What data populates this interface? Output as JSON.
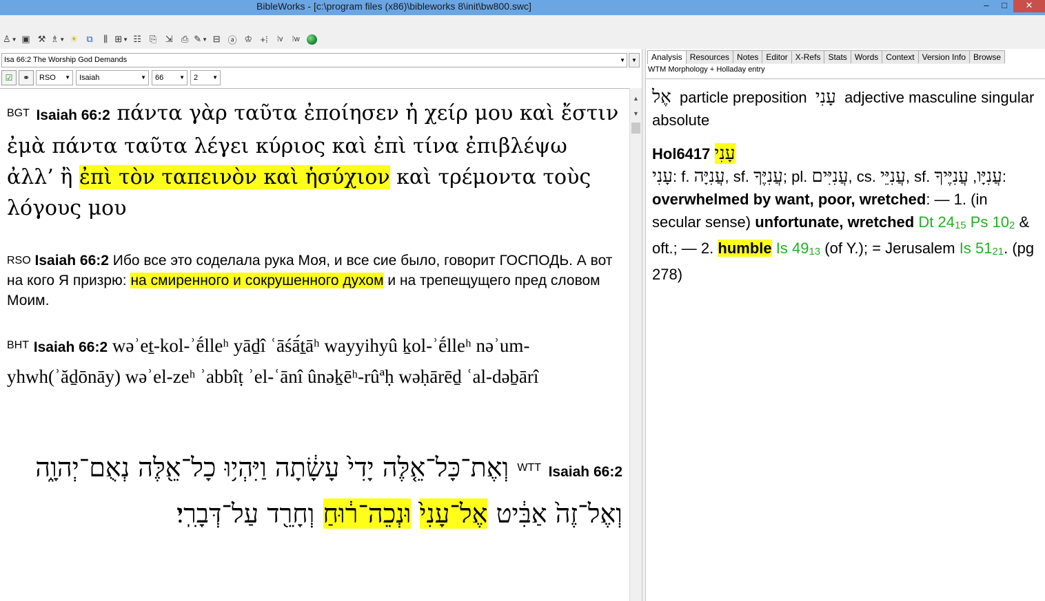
{
  "window": {
    "title": "BibleWorks - [c:\\program files (x86)\\bibleworks 8\\init\\bw800.swc]",
    "min": "–",
    "max": "□",
    "close": "✕"
  },
  "toolbar": {
    "icons": [
      "person-icon",
      "search-window-icon",
      "tools-icon",
      "lookup-icon",
      "highlight-icon",
      "windows-icon",
      "columns-icon",
      "grid-icon",
      "list-icon",
      "copy-icon",
      "export-icon",
      "print-icon",
      "notes-icon",
      "split-icon",
      "text-icon",
      "user-icon",
      "add-icon",
      "verse-icon",
      "word-icon",
      "globe-icon"
    ]
  },
  "left": {
    "verse_box": "Isa 66:2 The Worship God Demands",
    "version": "RSO",
    "book": "Isaiah",
    "chapter": "66",
    "verse": "2",
    "greek": {
      "version": "BGT",
      "ref": "Isaiah 66:2",
      "text_a": "πάντα γὰρ ταῦτα ἐποίησεν ἡ χείρ μου καὶ ἔστιν ἐμὰ πάντα ταῦτα λέγει κύριος καὶ ἐπὶ τίνα ἐπιβλέψω ἀλλ’ ἢ",
      "highlight": "ἐπὶ τὸν ταπεινὸν καὶ ἡσύχιον",
      "text_b": "καὶ τρέμοντα τοὺς λόγους μου"
    },
    "russian": {
      "version": "RSO",
      "ref": "Isaiah 66:2",
      "text_a": "Ибо все это соделала рука Моя, и все сие было, говорит ГОСПОДЬ. А вот на кого Я призрю:",
      "highlight": "на смиренного и сокрушенного духом",
      "text_b": "и на трепещущего пред словом Моим."
    },
    "translit": {
      "version": "BHT",
      "ref": "Isaiah 66:2",
      "text": "wǝʾeṯ-kol-ʾḗlleʰ yāḏî ʿāśā́ṯāʰ wayyihyû ḵol-ʾḗlleʰ nǝʾum-yhwh(ʾăḏōnāy) wǝʾel-zeʰ ʾabbîṭ ʾel-ʿānî ûnǝḵēʰ-rûªḥ wǝḥārēḏ ʿal-dǝḇārî"
    },
    "hebrew": {
      "version": "WTT",
      "ref": "Isaiah 66:2",
      "text_a": "וְאֶת־כָּל־אֵ֤לֶּה יָדִי֙ עָשָׂ֔תָה וַיִּהְי֥וּ כָל־אֵ֖לֶּה נְאֻם־יְהוָ֑ה וְאֶל־זֶה֙ אַבִּ֔יט",
      "highlight_a": "אֶל־עָנִי֙",
      "highlight_b": "וּנְכֵה־ר֔וּחַ",
      "text_b": "וְחָרֵ֖ד עַל־דְּבָרִֽי׃"
    }
  },
  "right": {
    "tabs": [
      "Analysis",
      "Resources",
      "Notes",
      "Editor",
      "X-Refs",
      "Stats",
      "Words",
      "Context",
      "Version Info",
      "Browse"
    ],
    "subhead": "WTM Morphology + Holladay entry",
    "morph": {
      "w1": "אֶל",
      "w1_desc": "particle preposition",
      "w2": "עָנִי",
      "w2_desc": "adjective masculine singular absolute"
    },
    "entry": {
      "id": "Hol6417",
      "lemma": "עָנִי",
      "forms_head": "עָנִי",
      "f_label": "f.",
      "f_form": "עֲנִיָּה",
      "sf_label": "sf.",
      "sf_form": "עֲנִיֶּךָ",
      "pl_label": "pl.",
      "pl_form": "עֲנִיִּים",
      "cs_label": "cs.",
      "cs_form": "עֲנִיֵּי",
      "sf2_label": "sf.",
      "sf2_form": "עֲנִיָּו",
      "sf3_form": "עֲנִיֶּיךָ",
      "gloss": "overwhelmed by want, poor, wretched",
      "sense1_lead": "1. (in secular sense)",
      "sense1_gloss": "unfortunate, wretched",
      "ref1": "Dt 24",
      "ref1_sub": "15",
      "ref2": "Ps 10",
      "ref2_sub": "2",
      "after_ref2": "& oft.; — 2.",
      "sense2_gloss": "humble",
      "ref3": "Is 49",
      "ref3_sub": "13",
      "after_ref3": "(of Y.); = Jerusalem",
      "ref4": "Is 51",
      "ref4_sub": "21",
      "page": ". (pg 278)"
    }
  }
}
